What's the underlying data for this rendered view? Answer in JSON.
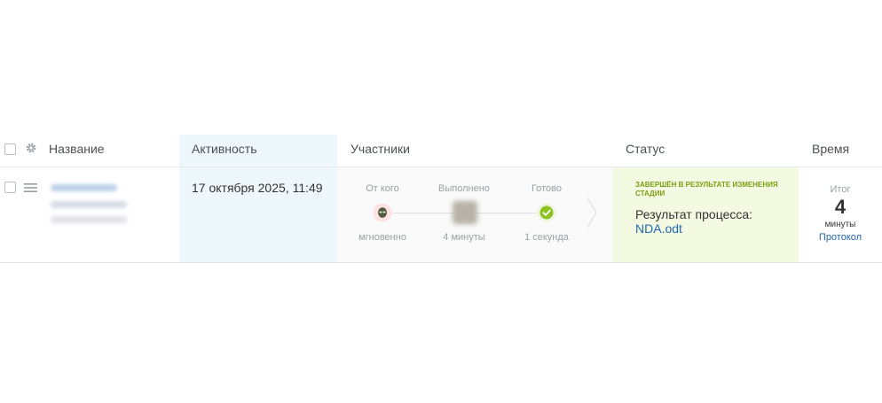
{
  "header": {
    "name": "Название",
    "activity": "Активность",
    "participants": "Участники",
    "status": "Статус",
    "time": "Время"
  },
  "row": {
    "activity_date": "17 октября 2025, 11:49",
    "stages": [
      {
        "label": "От кого",
        "sub": "мгновенно",
        "icon": "alien-avatar-icon"
      },
      {
        "label": "Выполнено",
        "sub": "4 минуты",
        "icon": "blurred-avatar-icon"
      },
      {
        "label": "Готово",
        "sub": "1 секунда",
        "icon": "check-icon"
      }
    ],
    "status": {
      "title": "Завершён в результате изменения стадии",
      "result_label": "Результат процесса:",
      "file": "NDA.odt"
    },
    "time": {
      "label": "Итог",
      "value": "4",
      "unit": "минуты",
      "link": "Протокол"
    }
  },
  "colors": {
    "activity_bg": "#eef8fc",
    "status_bg": "#f4fae2",
    "status_title": "#7a9e12",
    "link": "#2067b0",
    "check_green": "#8cc21f"
  }
}
